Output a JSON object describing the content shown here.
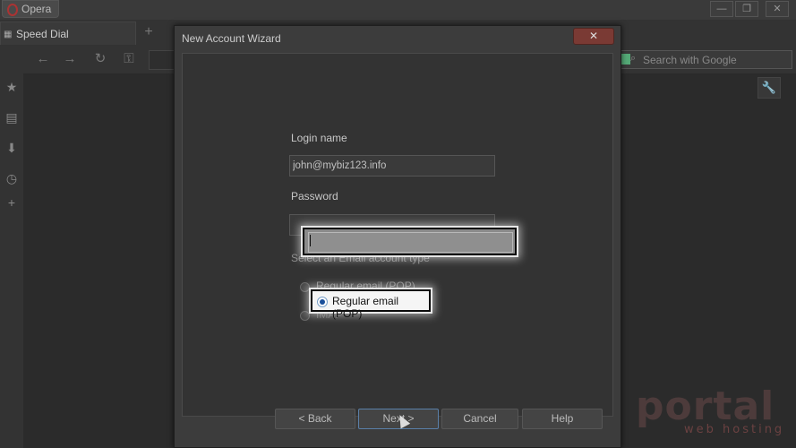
{
  "browser": {
    "opera_label": "Opera",
    "tab_label": "Speed Dial",
    "search_placeholder": "Search with Google",
    "window_controls": [
      "—",
      "❐",
      "✕"
    ]
  },
  "dialog": {
    "title": "New Account Wizard",
    "close_label": "✕",
    "login_label": "Login name",
    "login_value": "john@mybiz123.info",
    "password_label": "Password",
    "password_value": "",
    "account_type_label": "Select an Email account type",
    "options": [
      "Regular email (POP)",
      "IMAP"
    ],
    "selected_option": "Regular email (POP)",
    "buttons": {
      "back": "< Back",
      "next": "Next >",
      "cancel": "Cancel",
      "help": "Help"
    }
  },
  "highlight": {
    "option_label": "Regular email (POP)"
  },
  "watermark": {
    "brand": "portal",
    "tagline": "web hosting"
  }
}
